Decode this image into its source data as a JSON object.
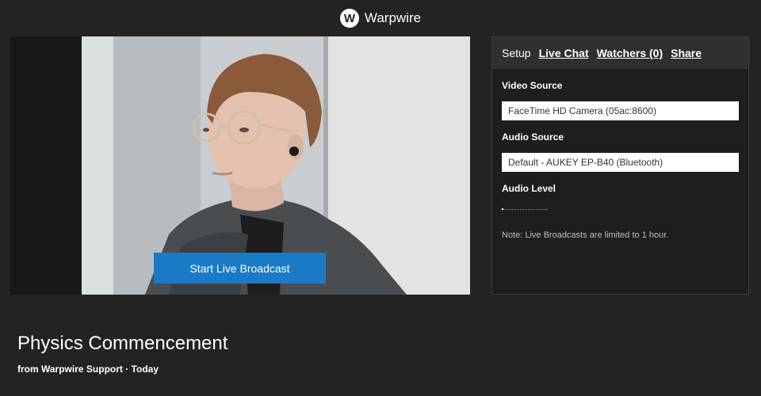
{
  "brand": {
    "name": "Warpwire",
    "logo_letter": "W"
  },
  "video": {
    "start_button_label": "Start Live Broadcast"
  },
  "panel": {
    "tabs": [
      {
        "label": "Setup"
      },
      {
        "label": "Live Chat"
      },
      {
        "label": "Watchers (0)"
      },
      {
        "label": "Share"
      }
    ],
    "video_source_label": "Video Source",
    "video_source_value": "FaceTime HD Camera (05ac:8600)",
    "audio_source_label": "Audio Source",
    "audio_source_value": "Default - AUKEY EP-B40 (Bluetooth)",
    "audio_level_label": "Audio Level",
    "audio_level": 0.03,
    "note": "Note: Live Broadcasts are limited to 1 hour."
  },
  "media": {
    "title": "Physics Commencement",
    "byline": "from Warpwire Support · Today"
  },
  "colors": {
    "accent": "#1b7ac6",
    "background": "#232323"
  }
}
